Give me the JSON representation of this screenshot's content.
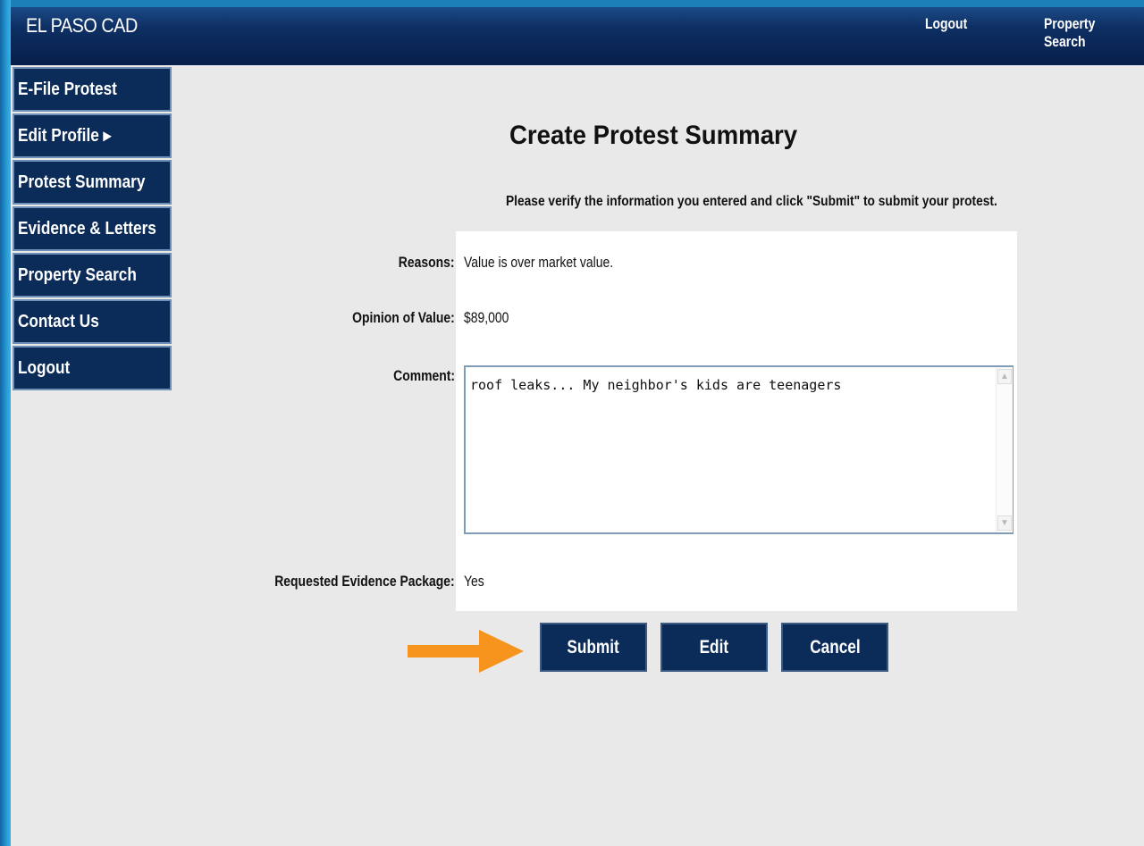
{
  "header": {
    "brand": "EL PASO CAD",
    "links": [
      "Logout",
      "Property Search"
    ]
  },
  "sidebar": {
    "items": [
      {
        "label": "E-File Protest"
      },
      {
        "label": "Edit Profile ▸"
      },
      {
        "label": "Protest Summary"
      },
      {
        "label": "Evidence & Letters"
      },
      {
        "label": "Property Search"
      },
      {
        "label": "Contact Us"
      },
      {
        "label": "Logout"
      }
    ]
  },
  "main": {
    "title": "Create Protest Summary",
    "instructions": "Please verify the information you entered and click \"Submit\" to submit your protest.",
    "fields": {
      "reasons": {
        "label": "Reasons:",
        "value": "Value is over market value."
      },
      "opinion": {
        "label": "Opinion of Value:",
        "value": "$89,000"
      },
      "comment": {
        "label": "Comment:",
        "value": "roof leaks... My neighbor's kids are teenagers"
      },
      "evidence": {
        "label": "Requested Evidence Package:",
        "value": "Yes"
      }
    },
    "buttons": {
      "submit": "Submit",
      "edit": "Edit",
      "cancel": "Cancel"
    }
  },
  "colors": {
    "nav_bg": "#0b2b58",
    "page_bg": "#e9e9e9",
    "arrow": "#f7941d",
    "desktop_blue": "#1d7fb8"
  }
}
